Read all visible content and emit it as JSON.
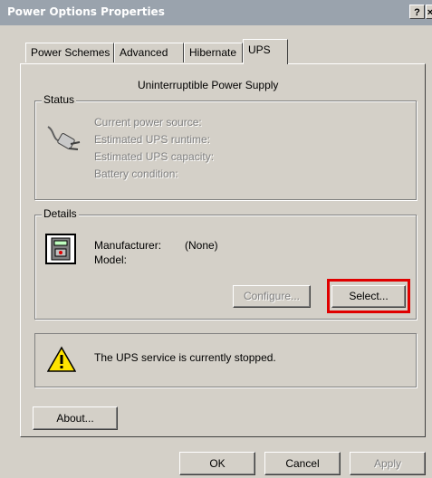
{
  "window": {
    "title": "Power Options Properties",
    "help_label": "?",
    "close_label": "×"
  },
  "tabs": [
    {
      "label": "Power Schemes",
      "active": false
    },
    {
      "label": "Advanced",
      "active": false
    },
    {
      "label": "Hibernate",
      "active": false
    },
    {
      "label": "UPS",
      "active": true
    }
  ],
  "ups": {
    "heading": "Uninterruptible Power Supply",
    "status": {
      "group_label": "Status",
      "icon": "power-plug-icon",
      "fields": [
        "Current power source:",
        "Estimated UPS runtime:",
        "Estimated UPS capacity:",
        "Battery condition:"
      ]
    },
    "details": {
      "group_label": "Details",
      "icon": "ups-device-icon",
      "manufacturer_label": "Manufacturer:",
      "manufacturer_value": "(None)",
      "model_label": "Model:",
      "configure_label": "Configure...",
      "select_label": "Select..."
    },
    "service": {
      "icon": "warning-icon",
      "message": "The UPS service is currently stopped."
    },
    "about_label": "About..."
  },
  "footer": {
    "ok_label": "OK",
    "cancel_label": "Cancel",
    "apply_label": "Apply"
  },
  "colors": {
    "face": "#d4d0c8",
    "title_bar": "#9aa3ad",
    "highlight": "#e00000"
  }
}
